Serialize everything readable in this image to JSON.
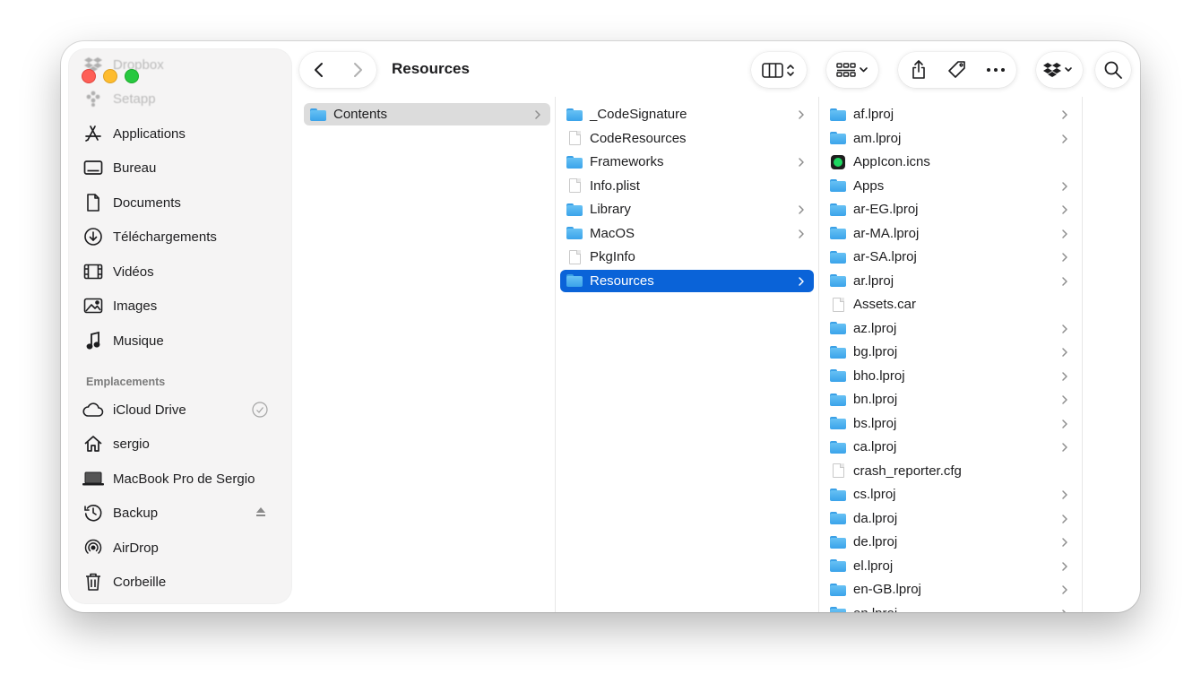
{
  "window": {
    "title": "Resources"
  },
  "sidebar": {
    "favorites": [
      {
        "label": "Dropbox",
        "icon": "dropbox-icon",
        "faded": true
      },
      {
        "label": "Setapp",
        "icon": "setapp-icon",
        "faded": true
      },
      {
        "label": "Applications",
        "icon": "applications-icon"
      },
      {
        "label": "Bureau",
        "icon": "desktop-icon"
      },
      {
        "label": "Documents",
        "icon": "document-icon"
      },
      {
        "label": "Téléchargements",
        "icon": "download-icon"
      },
      {
        "label": "Vidéos",
        "icon": "film-icon"
      },
      {
        "label": "Images",
        "icon": "photo-icon"
      },
      {
        "label": "Musique",
        "icon": "music-note-icon"
      }
    ],
    "locations_header": "Emplacements",
    "locations": [
      {
        "label": "iCloud Drive",
        "icon": "cloud-icon",
        "trailing": "sync-check-icon"
      },
      {
        "label": "sergio",
        "icon": "home-icon"
      },
      {
        "label": "MacBook Pro de Sergio",
        "icon": "laptop-icon"
      },
      {
        "label": "Backup",
        "icon": "time-machine-icon",
        "trailing": "eject-icon"
      },
      {
        "label": "AirDrop",
        "icon": "airdrop-icon"
      },
      {
        "label": "Corbeille",
        "icon": "trash-icon"
      }
    ]
  },
  "toolbar": {
    "buttons": [
      "back-chevron-icon",
      "forward-chevron-icon",
      "column-view-icon",
      "group-icon",
      "share-icon",
      "tag-icon",
      "more-icon",
      "dropbox-icon",
      "search-icon"
    ]
  },
  "columns": [
    [
      {
        "name": "Contents",
        "type": "folder",
        "chevron": true,
        "selected": "gray"
      }
    ],
    [
      {
        "name": "_CodeSignature",
        "type": "folder",
        "chevron": true
      },
      {
        "name": "CodeResources",
        "type": "file",
        "chevron": false
      },
      {
        "name": "Frameworks",
        "type": "folder",
        "chevron": true
      },
      {
        "name": "Info.plist",
        "type": "file",
        "chevron": false
      },
      {
        "name": "Library",
        "type": "folder",
        "chevron": true
      },
      {
        "name": "MacOS",
        "type": "folder",
        "chevron": true
      },
      {
        "name": "PkgInfo",
        "type": "file",
        "chevron": false
      },
      {
        "name": "Resources",
        "type": "folder",
        "chevron": true,
        "selected": "blue"
      }
    ],
    [
      {
        "name": "af.lproj",
        "type": "folder",
        "chevron": true
      },
      {
        "name": "am.lproj",
        "type": "folder",
        "chevron": true
      },
      {
        "name": "AppIcon.icns",
        "type": "icns",
        "chevron": false
      },
      {
        "name": "Apps",
        "type": "folder",
        "chevron": true
      },
      {
        "name": "ar-EG.lproj",
        "type": "folder",
        "chevron": true
      },
      {
        "name": "ar-MA.lproj",
        "type": "folder",
        "chevron": true
      },
      {
        "name": "ar-SA.lproj",
        "type": "folder",
        "chevron": true
      },
      {
        "name": "ar.lproj",
        "type": "folder",
        "chevron": true
      },
      {
        "name": "Assets.car",
        "type": "file",
        "chevron": false
      },
      {
        "name": "az.lproj",
        "type": "folder",
        "chevron": true
      },
      {
        "name": "bg.lproj",
        "type": "folder",
        "chevron": true
      },
      {
        "name": "bho.lproj",
        "type": "folder",
        "chevron": true
      },
      {
        "name": "bn.lproj",
        "type": "folder",
        "chevron": true
      },
      {
        "name": "bs.lproj",
        "type": "folder",
        "chevron": true
      },
      {
        "name": "ca.lproj",
        "type": "folder",
        "chevron": true
      },
      {
        "name": "crash_reporter.cfg",
        "type": "file",
        "chevron": false
      },
      {
        "name": "cs.lproj",
        "type": "folder",
        "chevron": true
      },
      {
        "name": "da.lproj",
        "type": "folder",
        "chevron": true
      },
      {
        "name": "de.lproj",
        "type": "folder",
        "chevron": true
      },
      {
        "name": "el.lproj",
        "type": "folder",
        "chevron": true
      },
      {
        "name": "en-GB.lproj",
        "type": "folder",
        "chevron": true
      },
      {
        "name": "en.lproj",
        "type": "folder",
        "chevron": true
      }
    ]
  ]
}
